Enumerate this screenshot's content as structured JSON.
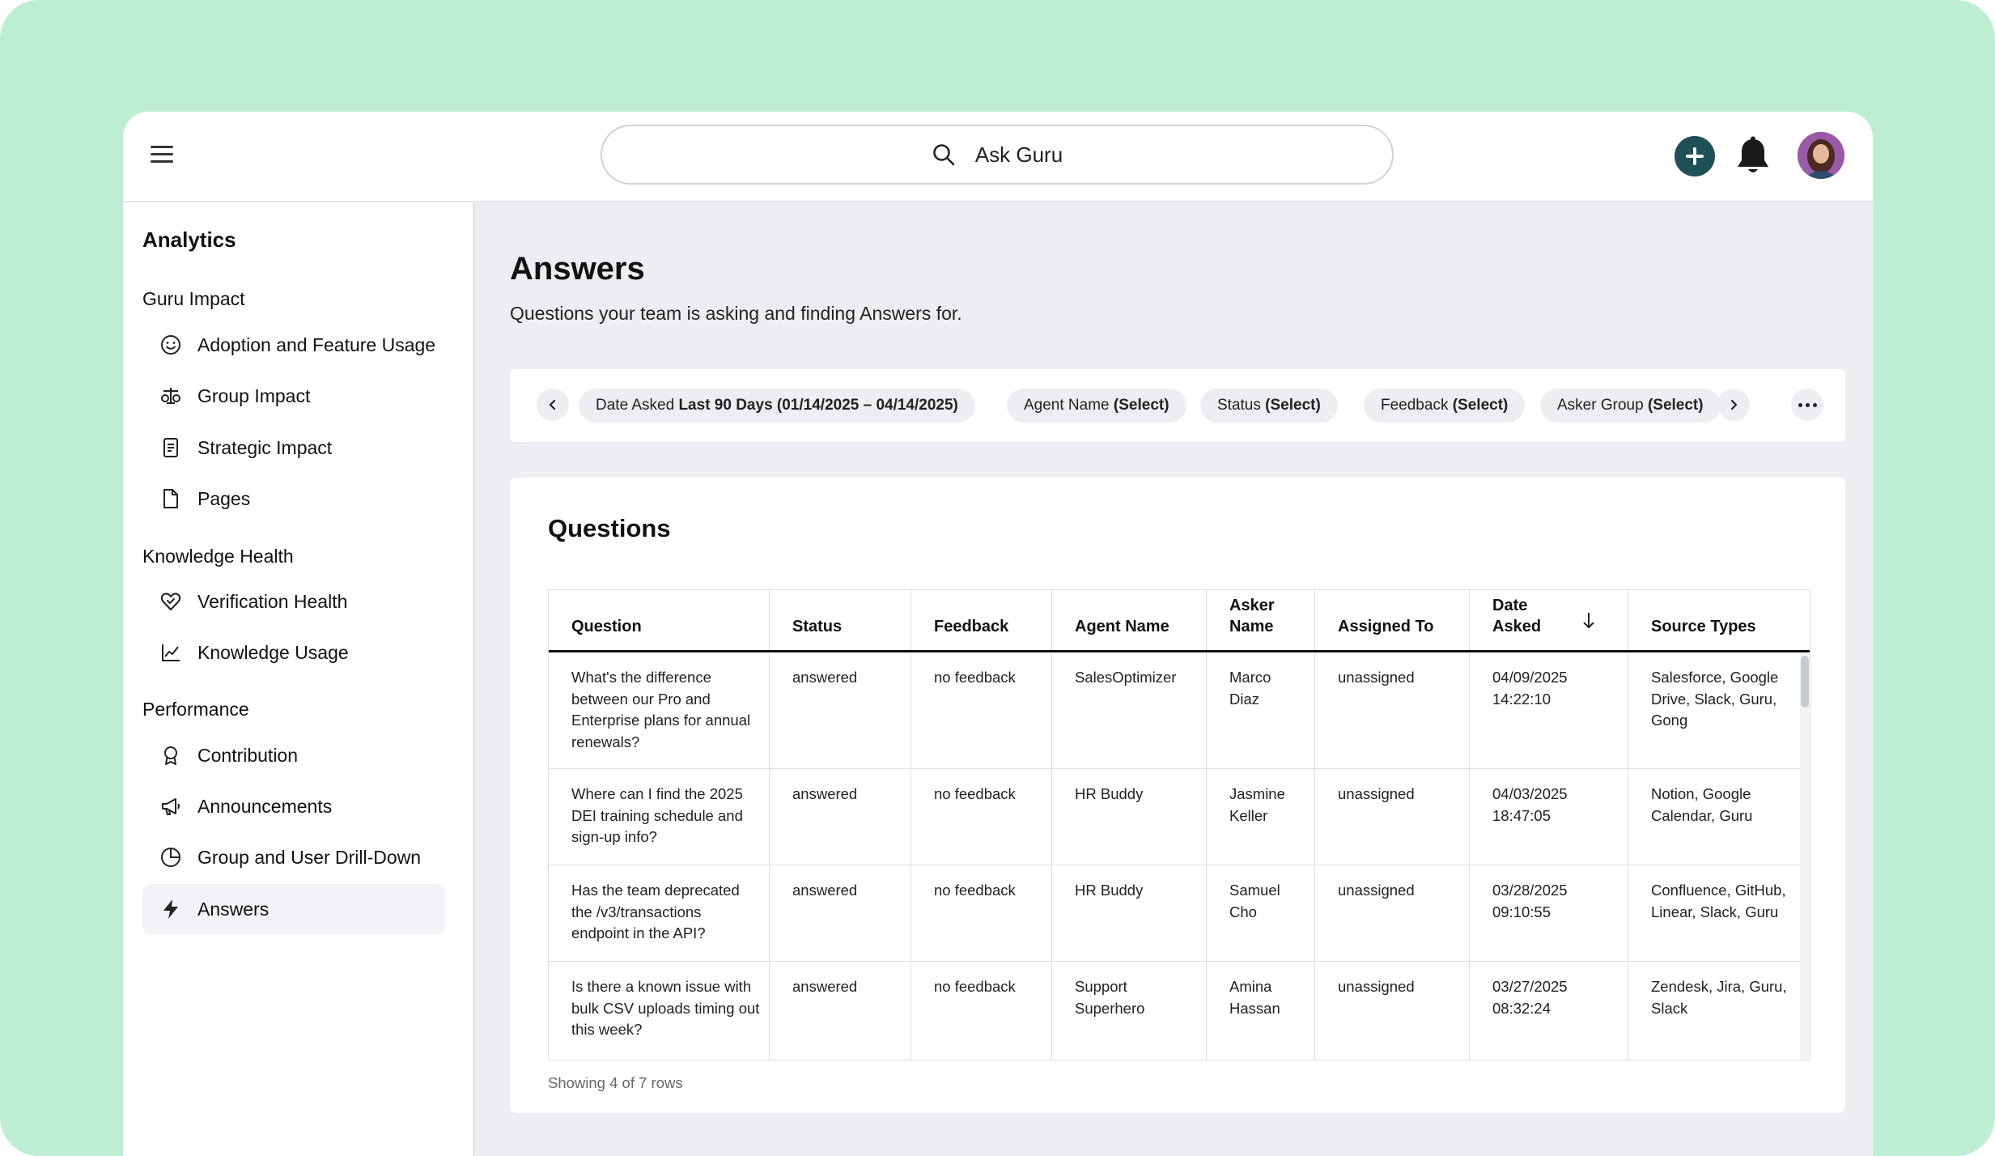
{
  "search": {
    "placeholder": "Ask Guru"
  },
  "sidebar": {
    "title": "Analytics",
    "sections": [
      {
        "label": "Guru Impact",
        "items": [
          {
            "label": "Adoption and Feature Usage",
            "icon": "smiley-icon"
          },
          {
            "label": "Group Impact",
            "icon": "scale-icon"
          },
          {
            "label": "Strategic Impact",
            "icon": "document-icon"
          },
          {
            "label": "Pages",
            "icon": "page-icon"
          }
        ]
      },
      {
        "label": "Knowledge Health",
        "items": [
          {
            "label": "Verification Health",
            "icon": "heart-check-icon"
          },
          {
            "label": "Knowledge Usage",
            "icon": "line-chart-icon"
          }
        ]
      },
      {
        "label": "Performance",
        "items": [
          {
            "label": "Contribution",
            "icon": "award-icon"
          },
          {
            "label": "Announcements",
            "icon": "megaphone-icon"
          },
          {
            "label": "Group and User Drill-Down",
            "icon": "pie-chart-icon"
          },
          {
            "label": "Answers",
            "icon": "lightning-icon",
            "active": true
          }
        ]
      }
    ]
  },
  "page": {
    "title": "Answers",
    "subtitle": "Questions your team is asking and finding Answers for."
  },
  "filters": {
    "date": {
      "label": "Date Asked",
      "value": "Last 90 Days (01/14/2025 – 04/14/2025)"
    },
    "agent": {
      "label": "Agent Name",
      "value": "(Select)"
    },
    "status": {
      "label": "Status",
      "value": "(Select)"
    },
    "feedback": {
      "label": "Feedback",
      "value": "(Select)"
    },
    "asker_group": {
      "label": "Asker Group",
      "value": "(Select)"
    }
  },
  "questions": {
    "title": "Questions",
    "columns": [
      "Question",
      "Status",
      "Feedback",
      "Agent Name",
      "Asker Name",
      "Assigned To",
      "Date Asked",
      "Source Types"
    ],
    "rows": [
      [
        "What's the difference between our Pro and Enterprise plans for annual renewals?",
        "answered",
        "no feedback",
        "SalesOptimizer",
        "Marco Diaz",
        "unassigned",
        "04/09/2025 14:22:10",
        "Salesforce, Google Drive, Slack, Guru, Gong"
      ],
      [
        "Where can I find the 2025 DEI training schedule and sign-up info?",
        "answered",
        "no feedback",
        "HR Buddy",
        "Jasmine Keller",
        "unassigned",
        "04/03/2025 18:47:05",
        "Notion, Google Calendar, Guru"
      ],
      [
        "Has the team deprecated the /v3/transactions endpoint in the API?",
        "answered",
        "no feedback",
        "HR Buddy",
        "Samuel Cho",
        "unassigned",
        "03/28/2025 09:10:55",
        "Confluence, GitHub, Linear, Slack, Guru"
      ],
      [
        "Is there a known issue with bulk CSV uploads timing out this week?",
        "answered",
        "no feedback",
        "Support Superhero",
        "Amina Hassan",
        "unassigned",
        "03/27/2025 08:32:24",
        "Zendesk, Jira, Guru, Slack"
      ]
    ],
    "footer": "Showing 4 of 7 rows"
  },
  "colors": {
    "background": "#bdeed2",
    "accent": "#1f4f57",
    "active_item": "#f1f3f6"
  }
}
